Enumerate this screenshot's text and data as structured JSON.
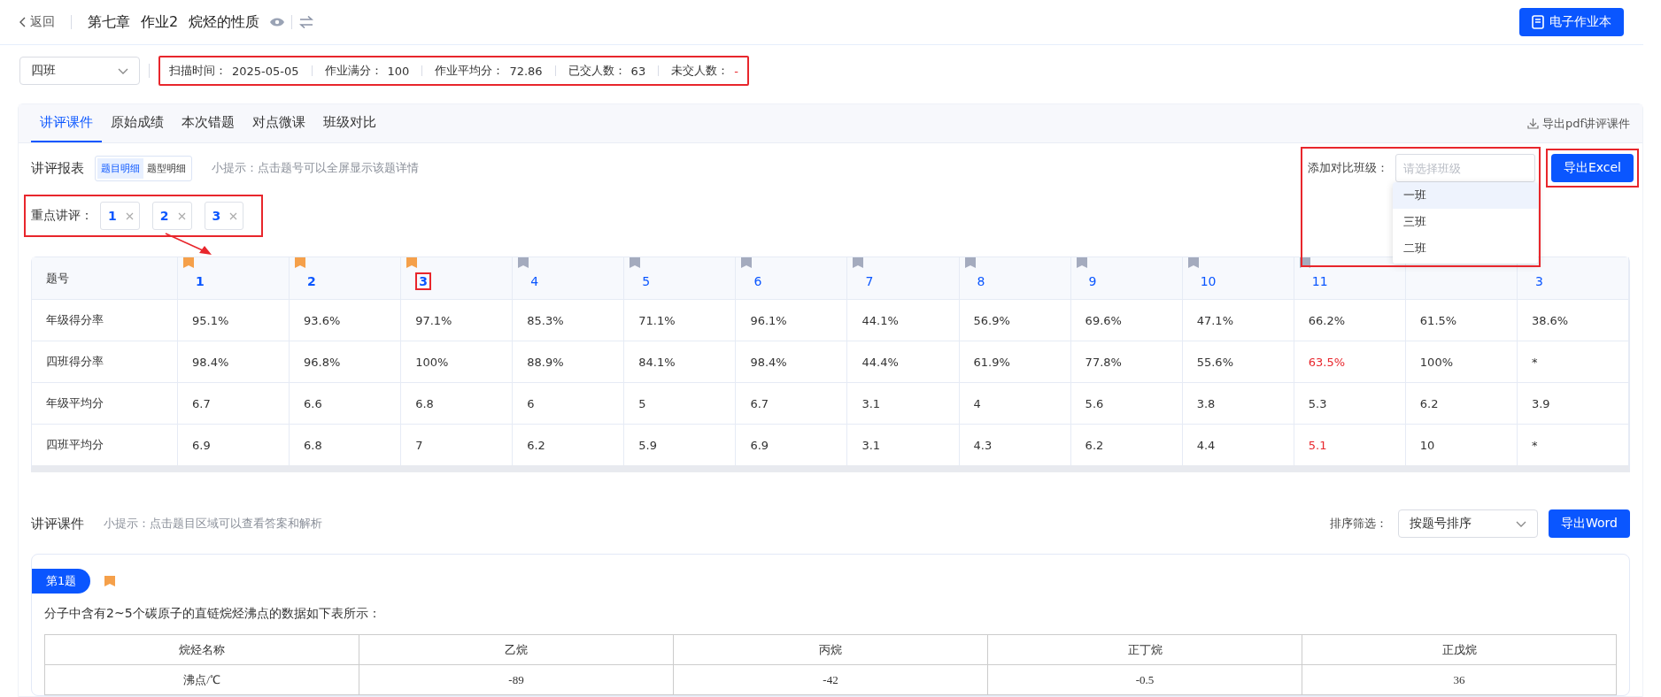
{
  "header": {
    "back": "返回",
    "title": [
      "第七章",
      "作业2",
      "烷烃的性质"
    ],
    "ebook_button": "电子作业本"
  },
  "class_select": {
    "value": "四班"
  },
  "stats": {
    "highlighted": true,
    "items": [
      {
        "label": "扫描时间：",
        "value": "2025-05-05",
        "alert": false
      },
      {
        "label": "作业满分：",
        "value": "100",
        "alert": false
      },
      {
        "label": "作业平均分：",
        "value": "72.86",
        "alert": false
      },
      {
        "label": "已交人数：",
        "value": "63",
        "alert": false
      },
      {
        "label": "未交人数：",
        "value": "-",
        "alert": true
      }
    ]
  },
  "tabs": [
    {
      "label": "讲评课件",
      "selected": true
    },
    {
      "label": "原始成绩",
      "selected": false
    },
    {
      "label": "本次错题",
      "selected": false
    },
    {
      "label": "对点微课",
      "selected": false
    },
    {
      "label": "班级对比",
      "selected": false
    }
  ],
  "export_pdf": "导出pdf讲评课件",
  "report": {
    "title": "讲评报表",
    "views": [
      {
        "label": "题目明细",
        "selected": true
      },
      {
        "label": "题型明细",
        "selected": false
      }
    ],
    "hint": "小提示：点击题号可以全屏显示该题详情",
    "compare": {
      "label": "添加对比班级：",
      "placeholder": "请选择班级",
      "highlighted": true,
      "options": [
        {
          "label": "一班",
          "selected": true
        },
        {
          "label": "三班",
          "selected": false
        },
        {
          "label": "二班",
          "selected": false
        }
      ]
    },
    "export_excel": {
      "label": "导出Excel",
      "highlighted": true
    }
  },
  "focus": {
    "label": "重点讲评：",
    "highlighted": true,
    "arrow": true,
    "tags": [
      "1",
      "2",
      "3"
    ]
  },
  "table": {
    "header": "题号",
    "questions": [
      {
        "number": "1",
        "key": true,
        "highlighted": false
      },
      {
        "number": "2",
        "key": true,
        "highlighted": false
      },
      {
        "number": "3",
        "key": true,
        "highlighted": true
      },
      {
        "number": "4",
        "key": false,
        "highlighted": false
      },
      {
        "number": "5",
        "key": false,
        "highlighted": false
      },
      {
        "number": "6",
        "key": false,
        "highlighted": false
      },
      {
        "number": "7",
        "key": false,
        "highlighted": false
      },
      {
        "number": "8",
        "key": false,
        "highlighted": false
      },
      {
        "number": "9",
        "key": false,
        "highlighted": false
      },
      {
        "number": "10",
        "key": false,
        "highlighted": false
      },
      {
        "number": "11",
        "key": false,
        "highlighted": false
      },
      {
        "covered": true
      },
      {
        "number": "3",
        "highlighted": false
      }
    ],
    "rows": [
      {
        "label": "年级得分率",
        "cells": [
          "95.1%",
          "93.6%",
          "97.1%",
          "85.3%",
          "71.1%",
          "96.1%",
          "44.1%",
          "56.9%",
          "69.6%",
          "47.1%",
          "66.2%",
          "61.5%",
          "38.6%"
        ]
      },
      {
        "label": "四班得分率",
        "cells": [
          "98.4%",
          "96.8%",
          "100%",
          "88.9%",
          "84.1%",
          "98.4%",
          "44.4%",
          "61.9%",
          "77.8%",
          "55.6%",
          {
            "text": "63.5%",
            "alert": true
          },
          "100%",
          "*"
        ]
      },
      {
        "label": "年级平均分",
        "cells": [
          "6.7",
          "6.6",
          "6.8",
          "6",
          "5",
          "6.7",
          "3.1",
          "4",
          "5.6",
          "3.8",
          "5.3",
          "6.2",
          "3.9"
        ]
      },
      {
        "label": "四班平均分",
        "cells": [
          "6.9",
          "6.8",
          "7",
          "6.2",
          "5.9",
          "6.9",
          "3.1",
          "4.3",
          "6.2",
          "4.4",
          {
            "text": "5.1",
            "alert": true
          },
          "10",
          "*"
        ]
      }
    ]
  },
  "courseware": {
    "title": "讲评课件",
    "hint": "小提示：点击题目区域可以查看答案和解析",
    "sort_label": "排序筛选：",
    "sort_value": "按题号排序",
    "export_word": "导出Word"
  },
  "question_card": {
    "badge": "第1题",
    "key": true,
    "text": "分子中含有2~5个碳原子的直链烷烃沸点的数据如下表所示：",
    "table": [
      [
        "烷烃名称",
        "乙烷",
        "丙烷",
        "正丁烷",
        "正戊烷"
      ],
      [
        "沸点/℃",
        "-89",
        "-42",
        "-0.5",
        "36"
      ]
    ]
  }
}
